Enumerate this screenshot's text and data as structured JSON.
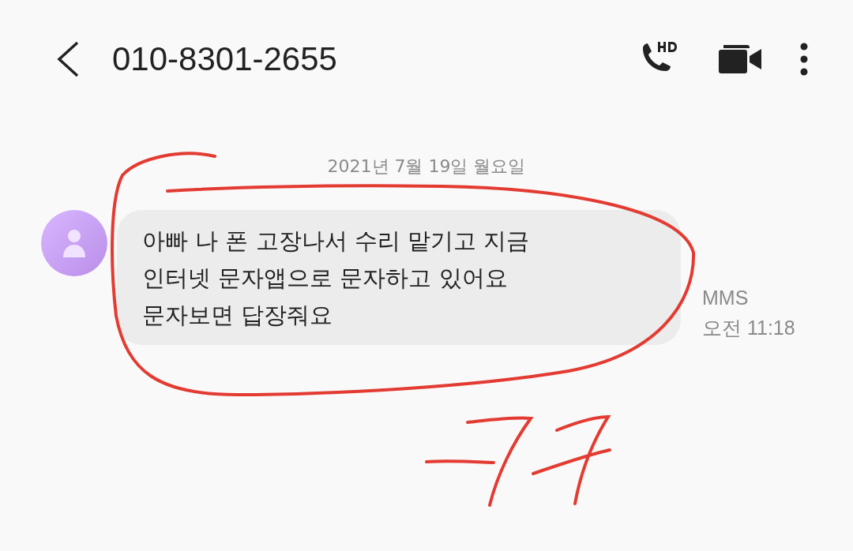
{
  "header": {
    "title": "010-8301-2655"
  },
  "date": "2021년 7월 19일 월요일",
  "message": {
    "text": "아빠 나 폰 고장나서 수리 맡기고 지금\n인터넷 문자앱으로 문자하고 있어요\n문자보면 답장줘요",
    "type": "MMS",
    "time": "오전 11:18"
  }
}
